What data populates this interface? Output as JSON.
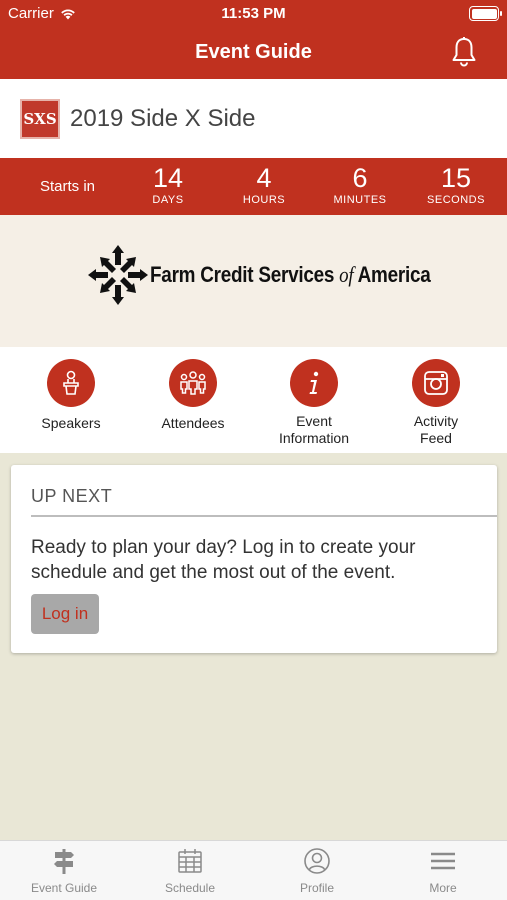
{
  "status_bar": {
    "carrier": "Carrier",
    "time": "11:53 PM"
  },
  "nav": {
    "title": "Event Guide"
  },
  "event": {
    "logo_text": "SXS",
    "name": "2019 Side X Side"
  },
  "countdown": {
    "label": "Starts in",
    "units": [
      {
        "value": "14",
        "caption": "DAYS"
      },
      {
        "value": "4",
        "caption": "HOURS"
      },
      {
        "value": "6",
        "caption": "MINUTES"
      },
      {
        "value": "15",
        "caption": "SECONDS"
      }
    ]
  },
  "banner": {
    "brand": "Farm Credit Services",
    "brand_of": "of",
    "brand_end": "America"
  },
  "quick_actions": [
    {
      "label": "Speakers",
      "icon": "speaker-podium-icon"
    },
    {
      "label": "Attendees",
      "icon": "attendees-group-icon"
    },
    {
      "label": "Event Information",
      "icon": "info-icon"
    },
    {
      "label": "Activity Feed",
      "icon": "instagram-camera-icon"
    }
  ],
  "up_next": {
    "title": "UP NEXT",
    "message": "Ready to plan your day? Log in to create your schedule and get the most out of the event.",
    "button_label": "Log in"
  },
  "tab_bar": [
    {
      "label": "Event Guide",
      "icon": "signpost-icon"
    },
    {
      "label": "Schedule",
      "icon": "calendar-icon"
    },
    {
      "label": "Profile",
      "icon": "profile-icon"
    },
    {
      "label": "More",
      "icon": "menu-icon"
    }
  ],
  "colors": {
    "brand_red": "#c0311f",
    "background": "#e9e7d6",
    "tab_inactive": "#8a8a8a"
  }
}
